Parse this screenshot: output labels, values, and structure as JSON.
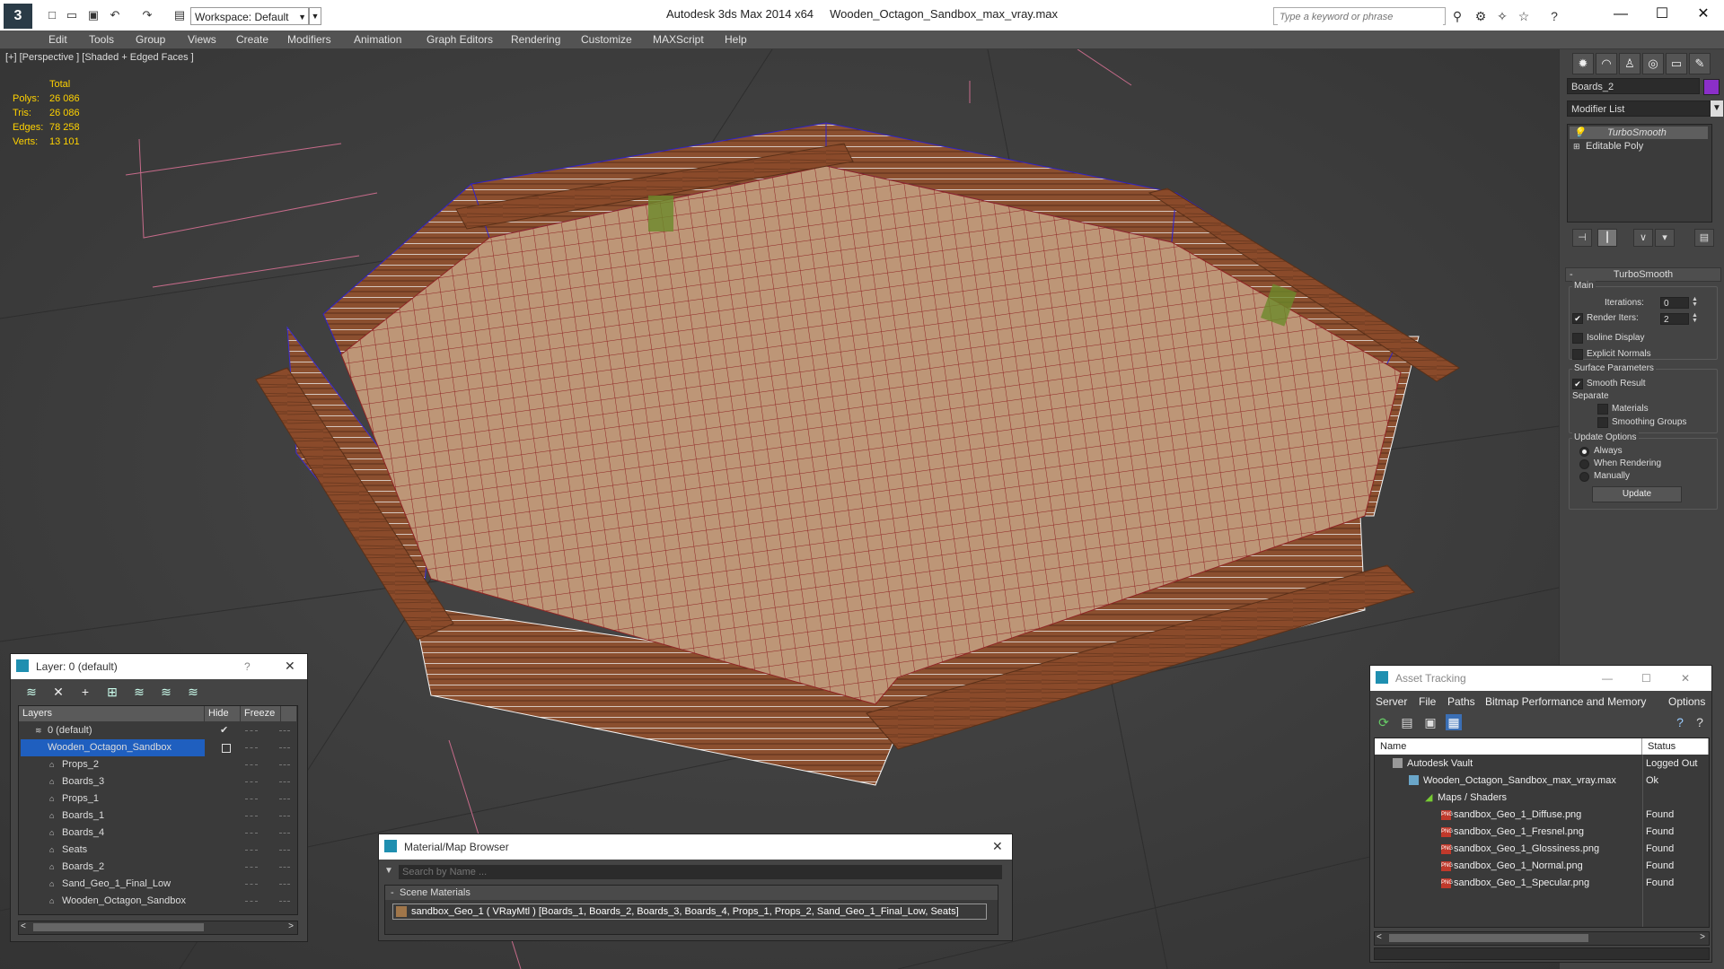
{
  "titlebar": {
    "app_title": "Autodesk 3ds Max  2014 x64",
    "file_title": "Wooden_Octagon_Sandbox_max_vray.max",
    "workspace": "Workspace: Default",
    "search_placeholder": "Type a keyword or phrase",
    "logo": "3"
  },
  "menu": [
    "Edit",
    "Tools",
    "Group",
    "Views",
    "Create",
    "Modifiers",
    "Animation",
    "Graph Editors",
    "Rendering",
    "Customize",
    "MAXScript",
    "Help"
  ],
  "viewport": {
    "label": "[+] [Perspective ] [Shaded + Edged Faces ]",
    "stats": {
      "total_label": "Total",
      "rows": [
        {
          "label": "Polys:",
          "value": "26 086"
        },
        {
          "label": "Tris:",
          "value": "26 086"
        },
        {
          "label": "Edges:",
          "value": "78 258"
        },
        {
          "label": "Verts:",
          "value": "13 101"
        }
      ]
    }
  },
  "command_panel": {
    "object_name": "Boards_2",
    "object_color": "#8b2fc9",
    "modifier_list": "Modifier List",
    "stack": [
      "TurboSmooth",
      "Editable Poly"
    ],
    "rollout_title": "TurboSmooth",
    "main_label": "Main",
    "iterations_label": "Iterations:",
    "iterations_value": "0",
    "render_iters_label": "Render Iters:",
    "render_iters_value": "2",
    "isoline_label": "Isoline Display",
    "explicit_normals_label": "Explicit Normals",
    "surface_params_label": "Surface Parameters",
    "smooth_result_label": "Smooth Result",
    "separate_label": "Separate",
    "materials_label": "Materials",
    "smoothing_groups_label": "Smoothing Groups",
    "update_options_label": "Update Options",
    "always_label": "Always",
    "when_rendering_label": "When Rendering",
    "manually_label": "Manually",
    "update_button": "Update"
  },
  "layer_window": {
    "title": "Layer: 0 (default)",
    "help": "?",
    "col_layers": "Layers",
    "col_hide": "Hide",
    "col_freeze": "Freeze",
    "rows": [
      {
        "name": "0 (default)",
        "indent": 0
      },
      {
        "name": "Wooden_Octagon_Sandbox",
        "indent": 0
      },
      {
        "name": "Props_2",
        "indent": 1
      },
      {
        "name": "Boards_3",
        "indent": 1
      },
      {
        "name": "Props_1",
        "indent": 1
      },
      {
        "name": "Boards_1",
        "indent": 1
      },
      {
        "name": "Boards_4",
        "indent": 1
      },
      {
        "name": "Seats",
        "indent": 1
      },
      {
        "name": "Boards_2",
        "indent": 1
      },
      {
        "name": "Sand_Geo_1_Final_Low",
        "indent": 1
      },
      {
        "name": "Wooden_Octagon_Sandbox",
        "indent": 1
      }
    ]
  },
  "material_browser": {
    "title": "Material/Map Browser",
    "search_placeholder": "Search by Name ...",
    "group": "Scene Materials",
    "item": "sandbox_Geo_1  ( VRayMtl ) [Boards_1, Boards_2, Boards_3, Boards_4, Props_1, Props_2, Sand_Geo_1_Final_Low, Seats]"
  },
  "asset_tracking": {
    "title": "Asset Tracking",
    "menu": [
      "Server",
      "File",
      "Paths",
      "Bitmap Performance and Memory",
      "Options"
    ],
    "col_name": "Name",
    "col_status": "Status",
    "rows": [
      {
        "name": "Autodesk Vault",
        "status": "Logged Out",
        "level": 0
      },
      {
        "name": "Wooden_Octagon_Sandbox_max_vray.max",
        "status": "Ok",
        "level": 1
      },
      {
        "name": "Maps / Shaders",
        "status": "",
        "level": 2
      },
      {
        "name": "sandbox_Geo_1_Diffuse.png",
        "status": "Found",
        "level": 3
      },
      {
        "name": "sandbox_Geo_1_Fresnel.png",
        "status": "Found",
        "level": 3
      },
      {
        "name": "sandbox_Geo_1_Glossiness.png",
        "status": "Found",
        "level": 3
      },
      {
        "name": "sandbox_Geo_1_Normal.png",
        "status": "Found",
        "level": 3
      },
      {
        "name": "sandbox_Geo_1_Specular.png",
        "status": "Found",
        "level": 3
      }
    ]
  }
}
